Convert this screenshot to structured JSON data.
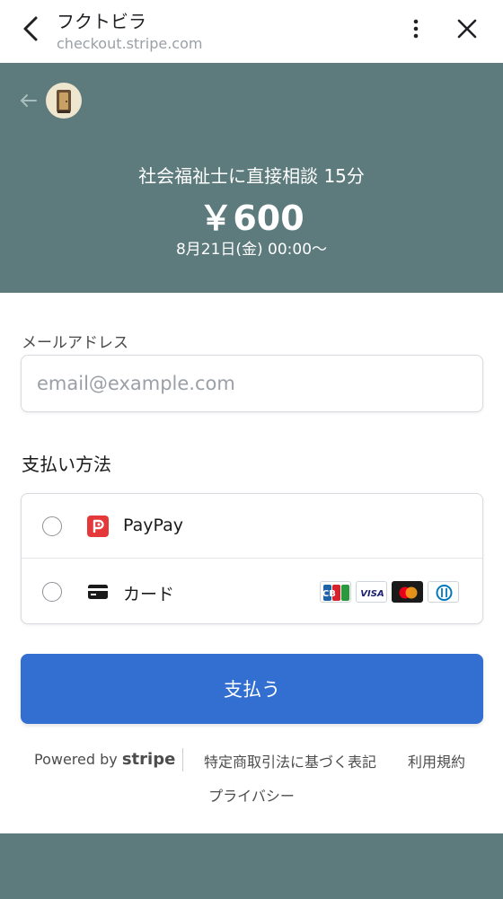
{
  "browser": {
    "title": "フクトビラ",
    "url": "checkout.stripe.com"
  },
  "header": {
    "product_name": "社会福祉士に直接相談 15分",
    "price": "￥600",
    "date": "8月21日(金) 00:00〜",
    "background_color": "#5d7b7c"
  },
  "form": {
    "email_label": "メールアドレス",
    "email_placeholder": "email@example.com",
    "email_value": "",
    "payment_method_heading": "支払い方法",
    "payment_methods": [
      {
        "label": "PayPay",
        "icon": "paypay-icon",
        "selected": false
      },
      {
        "label": "カード",
        "icon": "credit-card-icon",
        "selected": false
      }
    ],
    "card_brands": [
      "jcb-icon",
      "visa-icon",
      "mastercard-icon",
      "diners-club-icon"
    ],
    "card_brand_labels": {
      "jcb": "JCB",
      "visa": "VISA"
    },
    "pay_button_label": "支払う",
    "pay_button_color": "#326fd1"
  },
  "footer": {
    "powered_by": "Powered by",
    "stripe": "stripe",
    "links": [
      "特定商取引法に基づく表記",
      "利用規約",
      "プライバシー"
    ]
  }
}
